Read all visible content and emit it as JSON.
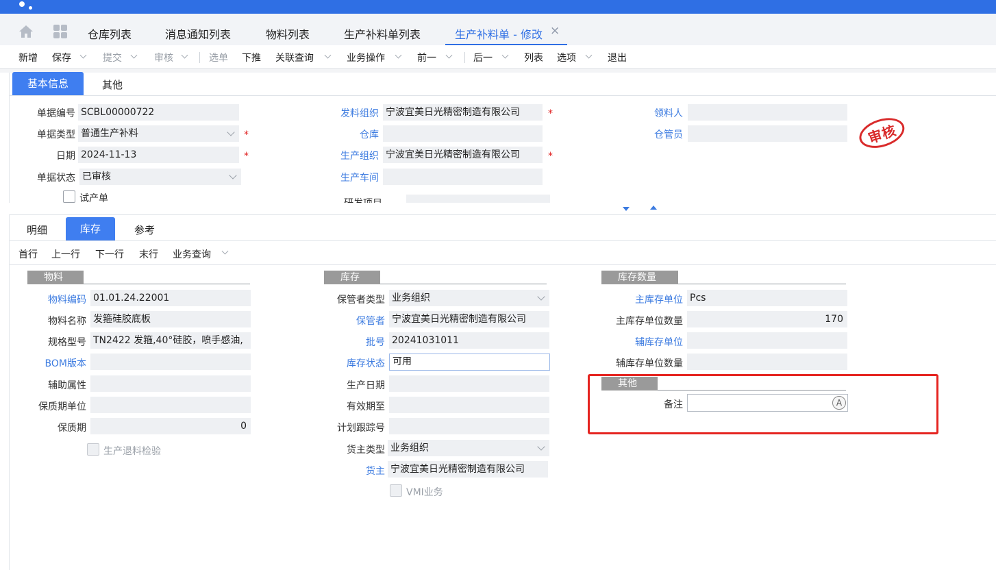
{
  "colors": {
    "accent": "#2f6fe4",
    "required": "#e02020",
    "stamp": "#d92b2b",
    "highlight_box": "#e52420"
  },
  "page_tabs": [
    {
      "label": "仓库列表"
    },
    {
      "label": "消息通知列表"
    },
    {
      "label": "物料列表"
    },
    {
      "label": "生产补料单列表"
    },
    {
      "label": "生产补料单 - 修改",
      "active": true
    }
  ],
  "close_glyph": "×",
  "toolbar": {
    "new": "新增",
    "save": "保存",
    "submit": "提交",
    "audit": "审核",
    "select": "选单",
    "push": "下推",
    "linked_query": "关联查询",
    "biz_ops": "业务操作",
    "prev": "前一",
    "next": "后一",
    "list": "列表",
    "options": "选项",
    "exit": "退出"
  },
  "header_tabs": {
    "basic": "基本信息",
    "other": "其他"
  },
  "header": {
    "doc_no_label": "单据编号",
    "doc_no": "SCBL00000722",
    "doc_type_label": "单据类型",
    "doc_type": "普通生产补料",
    "date_label": "日期",
    "date": "2024-11-13",
    "status_label": "单据状态",
    "status": "已审核",
    "trial_label": "试产单",
    "issue_org_label": "发料组织",
    "issue_org": "宁波宜美日光精密制造有限公司",
    "warehouse_label": "仓库",
    "warehouse": "",
    "prod_org_label": "生产组织",
    "prod_org": "宁波宜美日光精密制造有限公司",
    "workshop_label": "生产车间",
    "workshop": "",
    "rd_project_label": "研发项目",
    "picker_label": "领料人",
    "picker": "",
    "keeper_label": "仓管员",
    "keeper": "",
    "required_mark": "*",
    "stamp": "审核"
  },
  "detail_tabs": {
    "detail": "明细",
    "stock": "库存",
    "ref": "参考"
  },
  "row_nav": {
    "first": "首行",
    "prev": "上一行",
    "next": "下一行",
    "last": "末行",
    "query": "业务查询"
  },
  "material": {
    "section": "物料",
    "code_label": "物料编码",
    "code": "01.01.24.22001",
    "name_label": "物料名称",
    "name": "发箍硅胶底板",
    "spec_label": "规格型号",
    "spec": "TN2422 发箍,40°硅胶，喷手感油,",
    "bom_label": "BOM版本",
    "bom": "",
    "aux_label": "辅助属性",
    "aux": "",
    "shelf_unit_label": "保质期单位",
    "shelf_unit": "",
    "shelf_label": "保质期",
    "shelf": "0",
    "return_check_label": "生产退料检验"
  },
  "stock": {
    "section": "库存",
    "keeper_type_label": "保管者类型",
    "keeper_type": "业务组织",
    "keeper_label": "保管者",
    "keeper": "宁波宜美日光精密制造有限公司",
    "lot_label": "批号",
    "lot": "20241031011",
    "stock_status_label": "库存状态",
    "stock_status": "可用",
    "prod_date_label": "生产日期",
    "prod_date": "",
    "expiry_label": "有效期至",
    "expiry": "",
    "plan_track_label": "计划跟踪号",
    "plan_track": "",
    "owner_type_label": "货主类型",
    "owner_type": "业务组织",
    "owner_label": "货主",
    "owner": "宁波宜美日光精密制造有限公司",
    "vmi_label": "VMI业务"
  },
  "qty": {
    "section": "库存数量",
    "main_unit_label": "主库存单位",
    "main_unit": "Pcs",
    "main_qty_label": "主库存单位数量",
    "main_qty": "170",
    "aux_unit_label": "辅库存单位",
    "aux_unit": "",
    "aux_qty_label": "辅库存单位数量",
    "aux_qty": ""
  },
  "other": {
    "section": "其他",
    "remark_label": "备注",
    "remark": "",
    "remark_button": "A"
  }
}
